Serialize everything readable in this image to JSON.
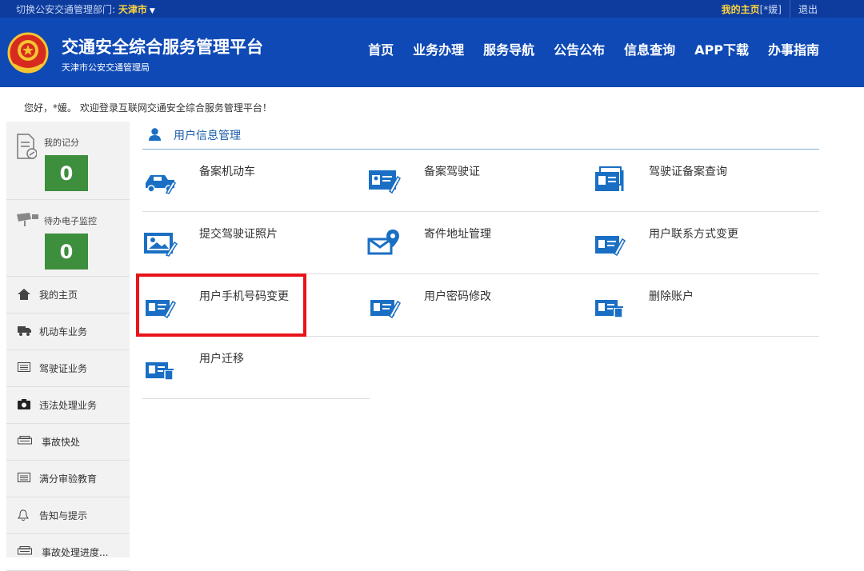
{
  "topbar": {
    "switch_label": "切换公安交通管理部门: ",
    "city": "天津市",
    "home_link": "我的主页",
    "user_tag": "[*媛]",
    "logout": "退出"
  },
  "header": {
    "site_title": "交通安全综合服务管理平台",
    "site_subtitle": "天津市公安交通管理局",
    "nav": [
      "首页",
      "业务办理",
      "服务导航",
      "公告公布",
      "信息查询",
      "APP下载",
      "办事指南"
    ]
  },
  "welcome": "您好，*媛。 欢迎登录互联网交通安全综合服务管理平台！",
  "sidebar": {
    "stats": [
      {
        "label": "我的记分",
        "value": "0"
      },
      {
        "label": "待办电子监控",
        "value": "0"
      }
    ],
    "items": [
      {
        "label": "我的主页",
        "icon": "home-icon"
      },
      {
        "label": "机动车业务",
        "icon": "truck-icon"
      },
      {
        "label": "驾驶证业务",
        "icon": "license-icon"
      },
      {
        "label": "违法处理业务",
        "icon": "camera-icon"
      },
      {
        "label": "事故快处",
        "icon": "car-front-icon"
      },
      {
        "label": "满分审验教育",
        "icon": "license-icon"
      },
      {
        "label": "告知与提示",
        "icon": "bell-icon"
      },
      {
        "label": "事故处理进度...",
        "icon": "car-front-icon"
      }
    ]
  },
  "panel": {
    "title": "用户信息管理",
    "rows": [
      [
        {
          "label": "备案机动车",
          "icon": "vehicle-icon"
        },
        {
          "label": "备案驾驶证",
          "icon": "id-card-edit-icon"
        },
        {
          "label": "驾驶证备案查询",
          "icon": "id-card-stack-icon"
        }
      ],
      [
        {
          "label": "提交驾驶证照片",
          "icon": "photo-icon"
        },
        {
          "label": "寄件地址管理",
          "icon": "mail-location-icon"
        },
        {
          "label": "用户联系方式变更",
          "icon": "contact-card-edit-icon"
        }
      ],
      [
        {
          "label": "用户手机号码变更",
          "icon": "phone-card-edit-icon"
        },
        {
          "label": "用户密码修改",
          "icon": "password-card-edit-icon"
        },
        {
          "label": "删除账户",
          "icon": "card-trash-icon"
        }
      ],
      [
        {
          "label": "用户迁移",
          "icon": "card-trash-icon"
        }
      ]
    ]
  },
  "colors": {
    "topbar": "#0d3c9e",
    "header": "#0e49b5",
    "accent_yellow": "#ffd33d",
    "count_green": "#3d8e3d",
    "icon_blue": "#1a6fc4",
    "highlight_red": "#e8141a"
  }
}
